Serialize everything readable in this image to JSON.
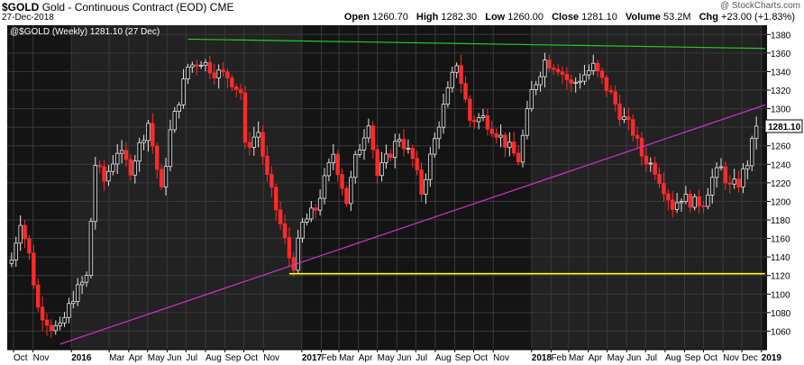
{
  "header": {
    "symbol": "$GOLD",
    "description": "Gold - Continuous Contract (EOD)",
    "exchange": "CME",
    "date": "27-Dec-2018",
    "credit": "@ StockCharts.com",
    "open_label": "Open",
    "open": "1260.70",
    "high_label": "High",
    "high": "1282.30",
    "low_label": "Low",
    "low": "1260.00",
    "close_label": "Close",
    "close": "1281.10",
    "volume_label": "Volume",
    "volume": "53.2M",
    "chg_label": "Chg",
    "chg": "+23.00 (+1.83%)"
  },
  "colors": {
    "plot_bg": "#141414",
    "band_bg": "#222222",
    "up": "#e6e6e6",
    "down": "#ff2a2a",
    "resistance": "#22cc22",
    "trend": "#cc33cc",
    "support": "#ffff00",
    "price_tag_bg": "#ffffff"
  },
  "chart_data": {
    "type": "candlestick",
    "legend": "@$GOLD (Weekly) 1281.10 (27 Dec)",
    "last_price": "1281.10",
    "ylim": [
      1040,
      1390
    ],
    "y_ticks": [
      1060,
      1080,
      1100,
      1120,
      1140,
      1160,
      1180,
      1200,
      1220,
      1240,
      1260,
      1280,
      1300,
      1320,
      1340,
      1360,
      1380
    ],
    "x_labels": [
      {
        "label": "Oct",
        "date": "2015-10-01",
        "bold": false
      },
      {
        "label": "Nov",
        "date": "2015-11-01",
        "bold": false
      },
      {
        "label": "2016",
        "date": "2016-01-01",
        "bold": true
      },
      {
        "label": "Mar",
        "date": "2016-03-01",
        "bold": false
      },
      {
        "label": "Apr",
        "date": "2016-04-01",
        "bold": false
      },
      {
        "label": "May",
        "date": "2016-05-01",
        "bold": false
      },
      {
        "label": "Jun",
        "date": "2016-06-01",
        "bold": false
      },
      {
        "label": "Jul",
        "date": "2016-07-01",
        "bold": false
      },
      {
        "label": "Aug",
        "date": "2016-08-01",
        "bold": false
      },
      {
        "label": "Sep",
        "date": "2016-09-01",
        "bold": false
      },
      {
        "label": "Oct",
        "date": "2016-10-01",
        "bold": false
      },
      {
        "label": "Nov",
        "date": "2016-11-01",
        "bold": false
      },
      {
        "label": "2017",
        "date": "2017-01-01",
        "bold": true
      },
      {
        "label": "Feb",
        "date": "2017-02-01",
        "bold": false
      },
      {
        "label": "Mar",
        "date": "2017-03-01",
        "bold": false
      },
      {
        "label": "Apr",
        "date": "2017-04-01",
        "bold": false
      },
      {
        "label": "May",
        "date": "2017-05-01",
        "bold": false
      },
      {
        "label": "Jun",
        "date": "2017-06-01",
        "bold": false
      },
      {
        "label": "Jul",
        "date": "2017-07-01",
        "bold": false
      },
      {
        "label": "Aug",
        "date": "2017-08-01",
        "bold": false
      },
      {
        "label": "Sep",
        "date": "2017-09-01",
        "bold": false
      },
      {
        "label": "Oct",
        "date": "2017-10-01",
        "bold": false
      },
      {
        "label": "Nov",
        "date": "2017-11-01",
        "bold": false
      },
      {
        "label": "2018",
        "date": "2018-01-01",
        "bold": true
      },
      {
        "label": "Feb",
        "date": "2018-02-01",
        "bold": false
      },
      {
        "label": "Mar",
        "date": "2018-03-01",
        "bold": false
      },
      {
        "label": "Apr",
        "date": "2018-04-01",
        "bold": false
      },
      {
        "label": "May",
        "date": "2018-05-01",
        "bold": false
      },
      {
        "label": "Jun",
        "date": "2018-06-01",
        "bold": false
      },
      {
        "label": "Jul",
        "date": "2018-07-01",
        "bold": false
      },
      {
        "label": "Aug",
        "date": "2018-08-01",
        "bold": false
      },
      {
        "label": "Sep",
        "date": "2018-09-01",
        "bold": false
      },
      {
        "label": "Oct",
        "date": "2018-10-01",
        "bold": false
      },
      {
        "label": "Nov",
        "date": "2018-11-01",
        "bold": false
      },
      {
        "label": "Dec",
        "date": "2018-12-01",
        "bold": false
      },
      {
        "label": "2019",
        "date": "2019-01-01",
        "bold": true
      }
    ],
    "weekly_close_anchors": [
      [
        "2015-09-28",
        1137
      ],
      [
        "2015-10-12",
        1180
      ],
      [
        "2015-10-26",
        1142
      ],
      [
        "2015-11-09",
        1085
      ],
      [
        "2015-11-30",
        1065
      ],
      [
        "2015-12-14",
        1062
      ],
      [
        "2016-01-04",
        1098
      ],
      [
        "2016-01-25",
        1118
      ],
      [
        "2016-02-08",
        1240
      ],
      [
        "2016-02-22",
        1222
      ],
      [
        "2016-03-14",
        1255
      ],
      [
        "2016-04-04",
        1235
      ],
      [
        "2016-05-02",
        1285
      ],
      [
        "2016-05-23",
        1210
      ],
      [
        "2016-06-06",
        1275
      ],
      [
        "2016-07-04",
        1345
      ],
      [
        "2016-07-25",
        1352
      ],
      [
        "2016-08-15",
        1340
      ],
      [
        "2016-09-05",
        1335
      ],
      [
        "2016-09-26",
        1318
      ],
      [
        "2016-10-03",
        1258
      ],
      [
        "2016-10-24",
        1275
      ],
      [
        "2016-11-07",
        1225
      ],
      [
        "2016-11-28",
        1175
      ],
      [
        "2016-12-12",
        1140
      ],
      [
        "2016-12-19",
        1132
      ],
      [
        "2017-01-02",
        1175
      ],
      [
        "2017-01-23",
        1192
      ],
      [
        "2017-02-20",
        1252
      ],
      [
        "2017-03-13",
        1200
      ],
      [
        "2017-03-27",
        1245
      ],
      [
        "2017-04-17",
        1288
      ],
      [
        "2017-05-01",
        1228
      ],
      [
        "2017-06-05",
        1270
      ],
      [
        "2017-06-26",
        1245
      ],
      [
        "2017-07-10",
        1210
      ],
      [
        "2017-08-07",
        1285
      ],
      [
        "2017-09-04",
        1350
      ],
      [
        "2017-09-25",
        1288
      ],
      [
        "2017-10-16",
        1290
      ],
      [
        "2017-11-06",
        1275
      ],
      [
        "2017-12-11",
        1245
      ],
      [
        "2018-01-01",
        1318
      ],
      [
        "2018-01-22",
        1352
      ],
      [
        "2018-02-12",
        1345
      ],
      [
        "2018-03-05",
        1325
      ],
      [
        "2018-04-09",
        1345
      ],
      [
        "2018-05-07",
        1315
      ],
      [
        "2018-05-21",
        1295
      ],
      [
        "2018-06-11",
        1275
      ],
      [
        "2018-06-25",
        1250
      ],
      [
        "2018-07-16",
        1235
      ],
      [
        "2018-08-13",
        1195
      ],
      [
        "2018-08-27",
        1205
      ],
      [
        "2018-09-17",
        1198
      ],
      [
        "2018-10-01",
        1200
      ],
      [
        "2018-10-15",
        1225
      ],
      [
        "2018-10-29",
        1235
      ],
      [
        "2018-11-12",
        1215
      ],
      [
        "2018-11-26",
        1220
      ],
      [
        "2018-12-10",
        1242
      ],
      [
        "2018-12-24",
        1281.1
      ]
    ],
    "lines": [
      {
        "name": "resistance",
        "from": [
          "2016-07-04",
          1375
        ],
        "to": [
          "2019-01-07",
          1365
        ]
      },
      {
        "name": "trend",
        "from": [
          "2015-12-14",
          1046
        ],
        "to": [
          "2019-01-07",
          1304
        ]
      },
      {
        "name": "support",
        "from": [
          "2016-12-12",
          1122
        ],
        "to": [
          "2019-01-07",
          1122
        ]
      }
    ]
  }
}
